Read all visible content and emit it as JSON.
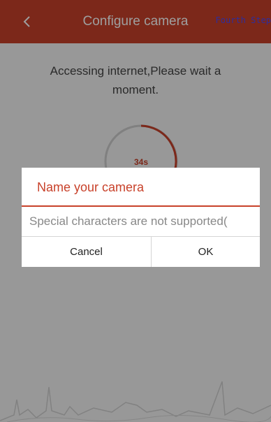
{
  "header": {
    "title": "Configure camera",
    "step_tag": "Fourth Step",
    "back_icon": "chevron-left-icon",
    "background_color": "#c8412a"
  },
  "main": {
    "status_message": "Accessing internet,Please wait a moment.",
    "timer_label": "34s",
    "accent_color": "#c8412a"
  },
  "dialog": {
    "title": "Name your camera",
    "input_placeholder": "Special characters are not supported(",
    "input_value": "",
    "cancel_label": "Cancel",
    "ok_label": "OK"
  }
}
